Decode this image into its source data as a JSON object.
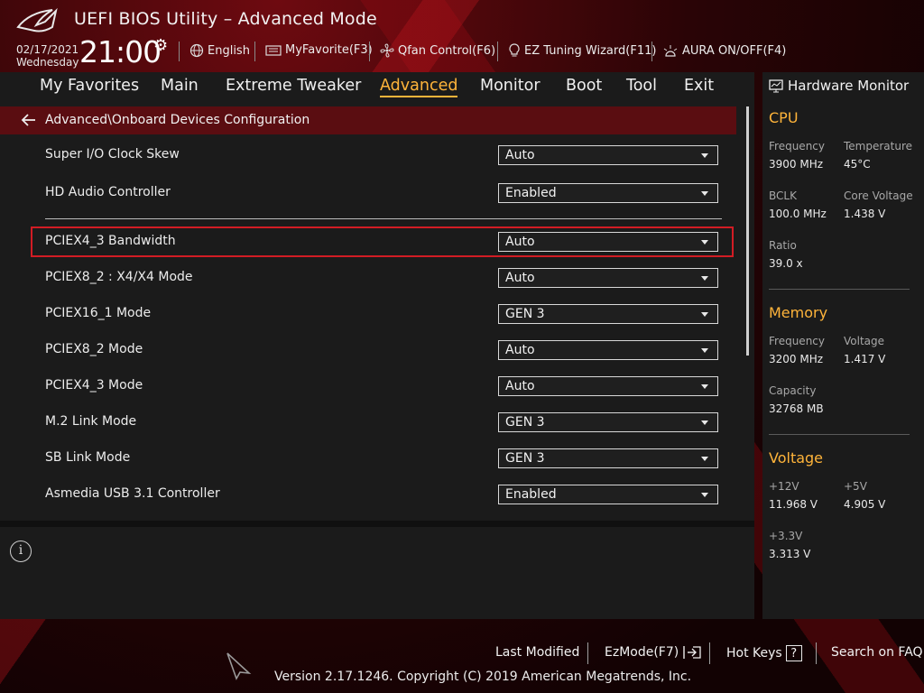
{
  "header": {
    "title": "UEFI BIOS Utility – Advanced Mode",
    "date": "02/17/2021",
    "day": "Wednesday",
    "time": "21:00",
    "toolbar": [
      {
        "icon": "globe-icon",
        "label": "English"
      },
      {
        "icon": "keyboard-icon",
        "label": "MyFavorite(F3)"
      },
      {
        "icon": "fan-icon",
        "label": "Qfan Control(F6)"
      },
      {
        "icon": "lightbulb-icon",
        "label": "EZ Tuning Wizard(F11)"
      },
      {
        "icon": "aura-icon",
        "label": "AURA ON/OFF(F4)"
      }
    ]
  },
  "nav": {
    "tabs": [
      "My Favorites",
      "Main",
      "Extreme Tweaker",
      "Advanced",
      "Monitor",
      "Boot",
      "Tool",
      "Exit"
    ],
    "active": "Advanced"
  },
  "breadcrumb": "Advanced\\Onboard Devices Configuration",
  "settings": [
    {
      "label": "Super I/O Clock Skew",
      "value": "Auto"
    },
    {
      "label": "HD Audio Controller",
      "value": "Enabled"
    },
    {
      "label": "PCIEX4_3 Bandwidth",
      "value": "Auto"
    },
    {
      "label": "PCIEX8_2 : X4/X4 Mode",
      "value": "Auto"
    },
    {
      "label": "PCIEX16_1 Mode",
      "value": "GEN 3"
    },
    {
      "label": "PCIEX8_2 Mode",
      "value": "Auto"
    },
    {
      "label": "PCIEX4_3 Mode",
      "value": "Auto"
    },
    {
      "label": "M.2 Link Mode",
      "value": "GEN 3"
    },
    {
      "label": "SB Link Mode",
      "value": "GEN 3"
    },
    {
      "label": "Asmedia USB 3.1 Controller",
      "value": "Enabled"
    }
  ],
  "selected_setting": "PCIEX4_3 Bandwidth",
  "hardware_monitor": {
    "title": "Hardware Monitor",
    "cpu": {
      "heading": "CPU",
      "frequency_label": "Frequency",
      "frequency": "3900 MHz",
      "temperature_label": "Temperature",
      "temperature": "45°C",
      "bclk_label": "BCLK",
      "bclk": "100.0 MHz",
      "core_voltage_label": "Core Voltage",
      "core_voltage": "1.438 V",
      "ratio_label": "Ratio",
      "ratio": "39.0 x"
    },
    "memory": {
      "heading": "Memory",
      "frequency_label": "Frequency",
      "frequency": "3200 MHz",
      "voltage_label": "Voltage",
      "voltage": "1.417 V",
      "capacity_label": "Capacity",
      "capacity": "32768 MB"
    },
    "voltage": {
      "heading": "Voltage",
      "v12_label": "+12V",
      "v12": "11.968 V",
      "v5_label": "+5V",
      "v5": "4.905 V",
      "v33_label": "+3.3V",
      "v33": "3.313 V"
    }
  },
  "footer": {
    "last_modified": "Last Modified",
    "ezmode": "EzMode(F7)",
    "hotkeys": "Hot Keys",
    "hotkeys_key": "?",
    "faq": "Search on FAQ",
    "version": "Version 2.17.1246. Copyright (C) 2019 American Megatrends, Inc."
  },
  "colors": {
    "accent": "#ffb43a",
    "highlight": "#d21c24",
    "crumb_bg": "#5a0d11"
  }
}
